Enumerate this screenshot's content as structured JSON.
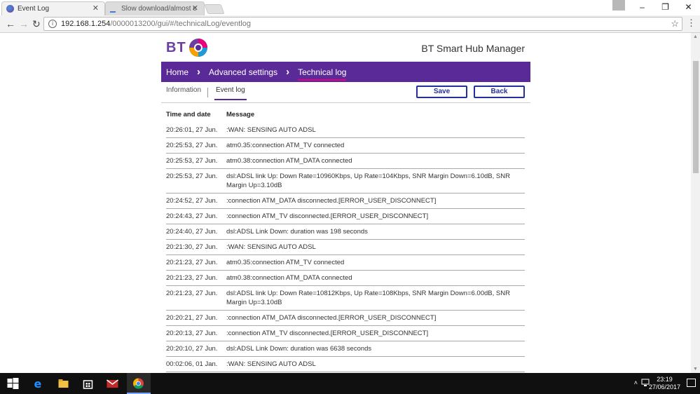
{
  "browser": {
    "tabs": [
      {
        "title": "Event Log",
        "active": true
      },
      {
        "title": "Slow download/almost c",
        "active": false
      }
    ],
    "url_host": "192.168.1.254",
    "url_path": "/0000013200/gui/#/technicalLog/eventlog",
    "window_controls": [
      "–",
      "❐",
      "✕"
    ]
  },
  "header": {
    "logo_text": "BT",
    "title": "BT Smart Hub Manager"
  },
  "breadcrumb": [
    {
      "label": "Home"
    },
    {
      "label": "Advanced settings"
    },
    {
      "label": "Technical log"
    }
  ],
  "subnav": {
    "tabs": [
      {
        "label": "Information"
      },
      {
        "label": "Event log"
      }
    ],
    "save_label": "Save",
    "back_label": "Back"
  },
  "log": {
    "col_time": "Time and date",
    "col_message": "Message",
    "rows": [
      {
        "time": "20:26:01, 27 Jun.",
        "message": ":WAN: SENSING AUTO ADSL"
      },
      {
        "time": "20:25:53, 27 Jun.",
        "message": "atm0.35:connection ATM_TV connected"
      },
      {
        "time": "20:25:53, 27 Jun.",
        "message": "atm0.38:connection ATM_DATA connected"
      },
      {
        "time": "20:25:53, 27 Jun.",
        "message": "dsl:ADSL link Up: Down Rate=10960Kbps, Up Rate=104Kbps, SNR Margin Down=6.10dB, SNR Margin Up=3.10dB"
      },
      {
        "time": "20:24:52, 27 Jun.",
        "message": ":connection ATM_DATA disconnected.[ERROR_USER_DISCONNECT]"
      },
      {
        "time": "20:24:43, 27 Jun.",
        "message": ":connection ATM_TV disconnected.[ERROR_USER_DISCONNECT]"
      },
      {
        "time": "20:24:40, 27 Jun.",
        "message": "dsl:ADSL Link Down: duration was 198 seconds"
      },
      {
        "time": "20:21:30, 27 Jun.",
        "message": ":WAN: SENSING AUTO ADSL"
      },
      {
        "time": "20:21:23, 27 Jun.",
        "message": "atm0.35:connection ATM_TV connected"
      },
      {
        "time": "20:21:23, 27 Jun.",
        "message": "atm0.38:connection ATM_DATA connected"
      },
      {
        "time": "20:21:23, 27 Jun.",
        "message": "dsl:ADSL link Up: Down Rate=10812Kbps, Up Rate=108Kbps, SNR Margin Down=6.00dB, SNR Margin Up=3.10dB"
      },
      {
        "time": "20:20:21, 27 Jun.",
        "message": ":connection ATM_DATA disconnected.[ERROR_USER_DISCONNECT]"
      },
      {
        "time": "20:20:13, 27 Jun.",
        "message": ":connection ATM_TV disconnected.[ERROR_USER_DISCONNECT]"
      },
      {
        "time": "20:20:10, 27 Jun.",
        "message": "dsl:ADSL Link Down: duration was 6638 seconds"
      },
      {
        "time": "00:02:06, 01 Jan.",
        "message": ":WAN: SENSING AUTO ADSL"
      },
      {
        "time": "00:01:53, 01 Jan.",
        "message": "atm0.35:connection ATM_TV connected"
      }
    ]
  },
  "taskbar": {
    "time": "23:19",
    "date": "27/06/2017"
  },
  "colors": {
    "bt_purple": "#5a2b98",
    "accent_pink": "#e6007e",
    "button_blue": "#23309c"
  }
}
